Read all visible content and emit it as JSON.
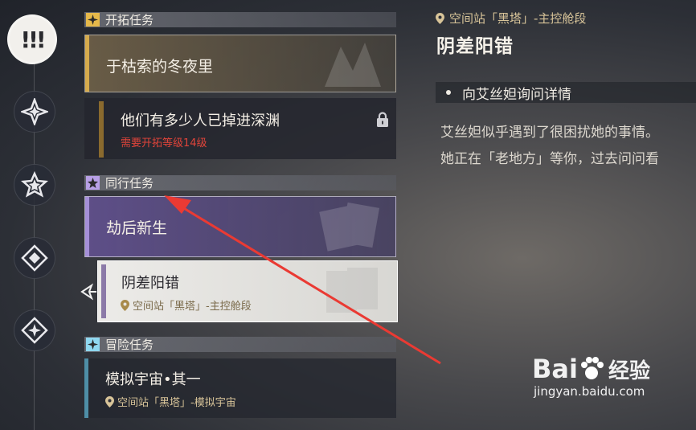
{
  "sidebar": {
    "items": [
      {
        "icon": "exclamation-icon",
        "glyph": "!!!",
        "active": true
      },
      {
        "icon": "star-diamond-icon",
        "active": false
      },
      {
        "icon": "star-icon",
        "active": false
      },
      {
        "icon": "diamond-icon",
        "active": false
      },
      {
        "icon": "sparkle-diamond-icon",
        "active": false
      }
    ]
  },
  "sections": {
    "trailblaze": {
      "title": "开拓任务",
      "color": "#e6b94a"
    },
    "companion": {
      "title": "同行任务",
      "color": "#b8a0e6"
    },
    "adventure": {
      "title": "冒险任务",
      "color": "#8fd8f0"
    }
  },
  "missions": {
    "m1": {
      "title": "于枯索的冬夜里",
      "accent": "#d6ab4c"
    },
    "m2": {
      "title": "他们有多少人已掉进深渊",
      "requirement": "需要开拓等级14级",
      "locked": true,
      "accent": "#8a6a2e",
      "req_color": "#e0443a"
    },
    "m3": {
      "title": "劫后新生",
      "accent": "#a58fd8"
    },
    "m4": {
      "title": "阴差阳错",
      "location": "空间站「黑塔」-主控舱段",
      "accent": "#8c7aa8",
      "selected": true
    },
    "m5": {
      "title": "模拟宇宙•其一",
      "location": "空间站「黑塔」-模拟宇宙",
      "accent": "#4e8ea6"
    }
  },
  "detail": {
    "location": "空间站「黑塔」-主控舱段",
    "title": "阴差阳错",
    "objective": "向艾丝妲询问详情",
    "description_lines": [
      "艾丝妲似乎遇到了很困扰她的事情。",
      "她正在「老地方」等你，过去问问看"
    ]
  },
  "watermark": {
    "brand": "Bai",
    "brand_suffix": "经验",
    "url": "jingyan.baidu.com"
  }
}
